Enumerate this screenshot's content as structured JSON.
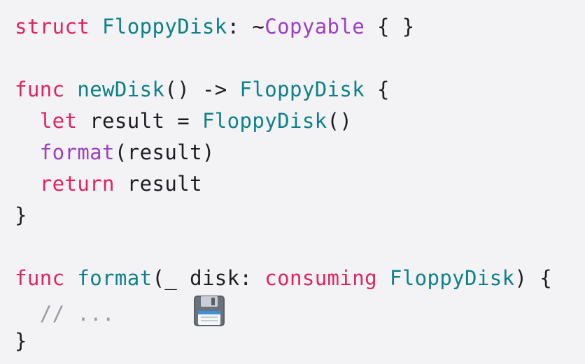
{
  "code": {
    "lines": [
      [
        {
          "text": "struct",
          "kind": "keyword"
        },
        {
          "text": " ",
          "kind": "plain"
        },
        {
          "text": "FloppyDisk",
          "kind": "type"
        },
        {
          "text": ": ~",
          "kind": "plain"
        },
        {
          "text": "Copyable",
          "kind": "protocol"
        },
        {
          "text": " { }",
          "kind": "plain"
        }
      ],
      [],
      [
        {
          "text": "func",
          "kind": "keyword"
        },
        {
          "text": " ",
          "kind": "plain"
        },
        {
          "text": "newDisk",
          "kind": "function"
        },
        {
          "text": "() -> ",
          "kind": "plain"
        },
        {
          "text": "FloppyDisk",
          "kind": "type"
        },
        {
          "text": " {",
          "kind": "plain"
        }
      ],
      [
        {
          "text": "  ",
          "kind": "plain"
        },
        {
          "text": "let",
          "kind": "keyword"
        },
        {
          "text": " result = ",
          "kind": "plain"
        },
        {
          "text": "FloppyDisk",
          "kind": "type"
        },
        {
          "text": "()",
          "kind": "plain"
        }
      ],
      [
        {
          "text": "  ",
          "kind": "plain"
        },
        {
          "text": "format",
          "kind": "call"
        },
        {
          "text": "(result)",
          "kind": "plain"
        }
      ],
      [
        {
          "text": "  ",
          "kind": "plain"
        },
        {
          "text": "return",
          "kind": "keyword"
        },
        {
          "text": " result",
          "kind": "plain"
        }
      ],
      [
        {
          "text": "}",
          "kind": "plain"
        }
      ],
      [],
      [
        {
          "text": "func",
          "kind": "keyword"
        },
        {
          "text": " ",
          "kind": "plain"
        },
        {
          "text": "format",
          "kind": "function"
        },
        {
          "text": "(_ disk: ",
          "kind": "plain"
        },
        {
          "text": "consuming",
          "kind": "keyword"
        },
        {
          "text": " ",
          "kind": "plain"
        },
        {
          "text": "FloppyDisk",
          "kind": "type"
        },
        {
          "text": ") {",
          "kind": "plain"
        }
      ],
      [
        {
          "text": "  // ...",
          "kind": "comment"
        },
        {
          "text": "      ",
          "kind": "plain"
        },
        {
          "icon": "floppy-disk-icon"
        }
      ],
      [
        {
          "text": "}",
          "kind": "plain"
        }
      ]
    ]
  },
  "colors": {
    "background": "#f3f3f6",
    "keyword": "#e0245e",
    "type": "#0e8089",
    "function": "#0e8089",
    "protocol": "#9d3ec4",
    "call": "#9d3ec4",
    "plain": "#1c1c22",
    "comment": "#9a9aa2"
  }
}
